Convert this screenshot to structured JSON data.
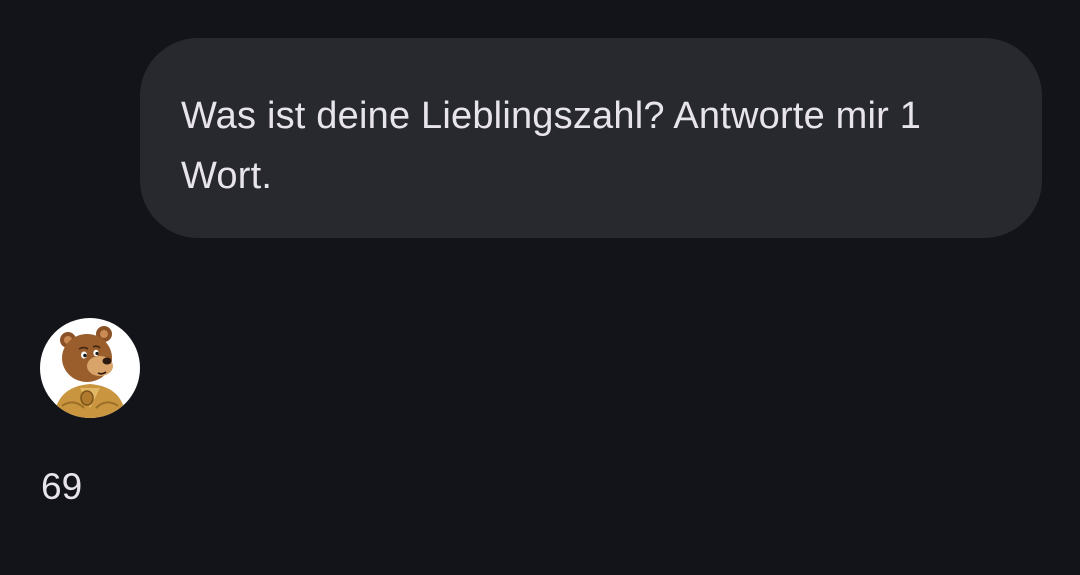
{
  "conversation": {
    "user_message": {
      "text": "Was ist deine Lieblingszahl? Antworte mir 1 Wort."
    },
    "assistant": {
      "avatar_icon": "bear-avatar-icon",
      "reply_text": "69"
    }
  },
  "colors": {
    "background": "#131419",
    "user_bubble": "#28292f",
    "text": "#e7e4ec"
  }
}
